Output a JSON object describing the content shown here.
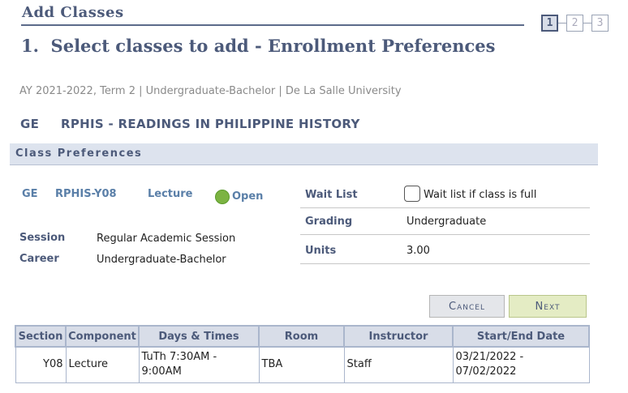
{
  "header": {
    "title": "Add Classes"
  },
  "steps": [
    "1",
    "2",
    "3"
  ],
  "page_title": "1.  Select classes to add - Enrollment Preferences",
  "term_info": "AY 2021-2022, Term 2 | Undergraduate-Bachelor | De La Salle University",
  "course": {
    "subject": "GE",
    "title": "RPHIS - READINGS IN PHILIPPINE HISTORY"
  },
  "section_header": "Class Preferences",
  "class": {
    "subject": "GE",
    "code": "RPHIS-Y08",
    "component": "Lecture",
    "status": "Open",
    "status_color": "#7cb342"
  },
  "session": {
    "label": "Session",
    "value": "Regular Academic Session"
  },
  "career": {
    "label": "Career",
    "value": "Undergraduate-Bachelor"
  },
  "wait_list": {
    "label": "Wait List",
    "checkbox_label": "Wait list if class is full",
    "checked": false
  },
  "grading": {
    "label": "Grading",
    "value": "Undergraduate"
  },
  "units": {
    "label": "Units",
    "value": "3.00"
  },
  "buttons": {
    "cancel": "Cancel",
    "next": "Next"
  },
  "table": {
    "headers": [
      "Section",
      "Component",
      "Days & Times",
      "Room",
      "Instructor",
      "Start/End Date"
    ],
    "rows": [
      {
        "section": "Y08",
        "component": "Lecture",
        "days_times": "TuTh 7:30AM - 9:00AM",
        "room": "TBA",
        "instructor": "Staff",
        "dates": "03/21/2022 - 07/02/2022"
      }
    ]
  }
}
